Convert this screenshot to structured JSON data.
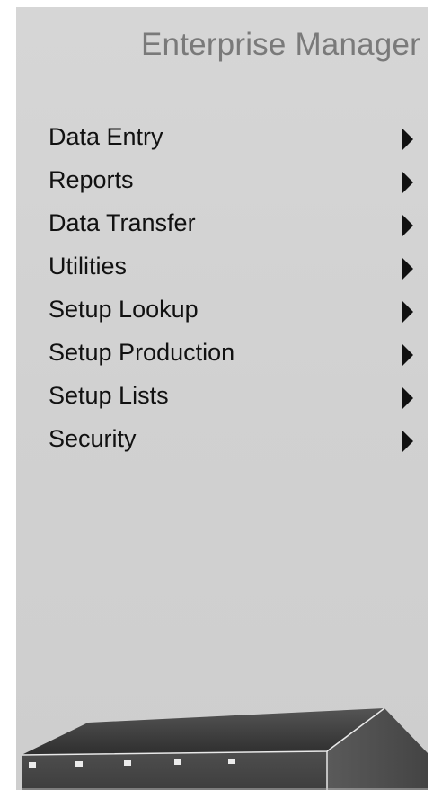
{
  "app": {
    "title": "Enterprise Manager"
  },
  "menu": {
    "items": [
      {
        "label": "Data Entry",
        "icon": "submenu-arrow-icon"
      },
      {
        "label": "Reports",
        "icon": "submenu-arrow-icon"
      },
      {
        "label": "Data Transfer",
        "icon": "submenu-arrow-icon"
      },
      {
        "label": "Utilities",
        "icon": "submenu-arrow-icon"
      },
      {
        "label": "Setup Lookup",
        "icon": "submenu-arrow-icon"
      },
      {
        "label": "Setup Production",
        "icon": "submenu-arrow-icon"
      },
      {
        "label": "Setup Lists",
        "icon": "submenu-arrow-icon"
      },
      {
        "label": "Security",
        "icon": "submenu-arrow-icon"
      }
    ]
  },
  "colors": {
    "panel_background": "#d3d3d3",
    "title_text": "#7a7a7a",
    "menu_text": "#111111",
    "building_roof": "#3a3a3a",
    "building_wall": "#4a4a4a"
  },
  "graphics": {
    "footer_image": "warehouse-building-icon"
  }
}
